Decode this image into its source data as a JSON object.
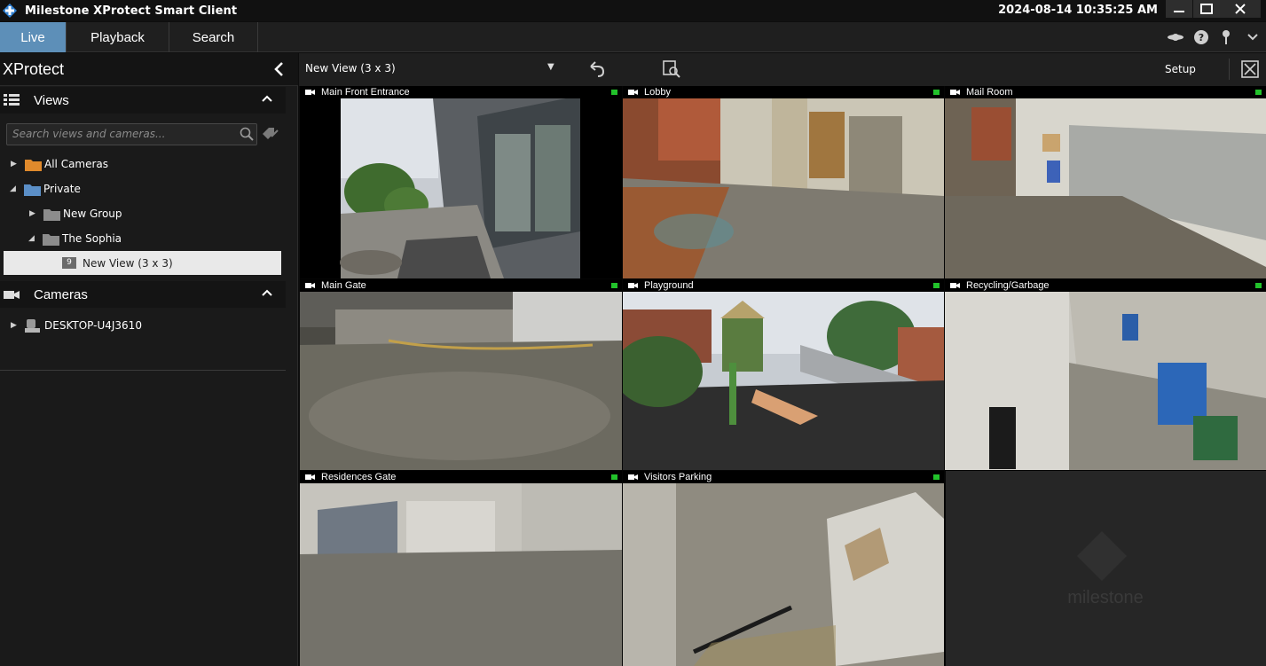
{
  "window": {
    "title": "Milestone XProtect Smart Client",
    "clock": "2024-08-14 10:35:25 AM",
    "controls": {
      "minimize": "▁",
      "maximize": "▢",
      "close": "✕"
    }
  },
  "tabs": [
    {
      "label": "Live",
      "active": true
    },
    {
      "label": "Playback",
      "active": false
    },
    {
      "label": "Search",
      "active": false
    }
  ],
  "top_icons": [
    "status-icon",
    "help-icon",
    "pin-icon",
    "menu-chevron-icon"
  ],
  "sidebar": {
    "title": "XProtect",
    "views_section": {
      "title": "Views"
    },
    "search": {
      "placeholder": "Search views and cameras..."
    },
    "tree": [
      {
        "label": "All Cameras",
        "expanded": false,
        "level": 0
      },
      {
        "label": "Private",
        "expanded": true,
        "level": 0
      },
      {
        "label": "New Group",
        "expanded": false,
        "level": 1
      },
      {
        "label": "The Sophia",
        "expanded": true,
        "level": 1
      },
      {
        "label": "New View (3 x 3)",
        "badge": "9",
        "selected": true,
        "level": 2
      }
    ],
    "cameras_section": {
      "title": "Cameras"
    },
    "camera_tree": [
      {
        "label": "DESKTOP-U4J3610",
        "expanded": false
      }
    ]
  },
  "view_toolbar": {
    "view_name": "New View (3 x 3)",
    "setup_label": "Setup"
  },
  "cameras": [
    {
      "name": "Main Front Entrance",
      "selected": true,
      "recording_color": "#22c22b"
    },
    {
      "name": "Lobby",
      "selected": false,
      "recording_color": "#22c22b"
    },
    {
      "name": "Mail Room",
      "selected": false,
      "recording_color": "#22c22b"
    },
    {
      "name": "Main Gate",
      "selected": false,
      "recording_color": "#22c22b"
    },
    {
      "name": "Playground",
      "selected": false,
      "recording_color": "#22c22b"
    },
    {
      "name": "Recycling/Garbage",
      "selected": false,
      "recording_color": "#22c22b"
    },
    {
      "name": "Residences Gate",
      "selected": false,
      "recording_color": "#22c22b"
    },
    {
      "name": "Visitors Parking",
      "selected": false,
      "recording_color": "#22c22b"
    }
  ],
  "empty_slot": {
    "watermark": "milestone"
  },
  "colors": {
    "accent": "#5d8fb8",
    "selection_outline": "#3d8ad6",
    "recording": "#22c22b"
  }
}
